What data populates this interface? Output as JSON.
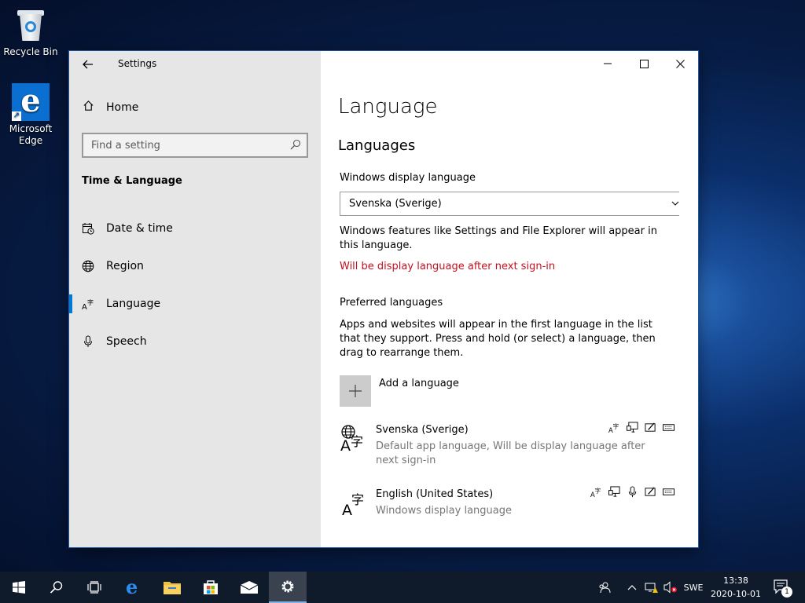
{
  "desktop": {
    "icons": [
      {
        "label": "Recycle Bin"
      },
      {
        "label": "Microsoft Edge"
      }
    ]
  },
  "window": {
    "title": "Settings",
    "sidebar": {
      "home_label": "Home",
      "search_placeholder": "Find a setting",
      "section_title": "Time & Language",
      "items": [
        {
          "label": "Date & time",
          "icon": "calendar-clock-icon"
        },
        {
          "label": "Region",
          "icon": "globe-icon"
        },
        {
          "label": "Language",
          "icon": "language-icon",
          "active": true
        },
        {
          "label": "Speech",
          "icon": "microphone-icon"
        }
      ]
    },
    "content": {
      "page_title": "Language",
      "section_title": "Languages",
      "display_language_label": "Windows display language",
      "display_language_value": "Svenska (Sverige)",
      "display_language_note": "Windows features like Settings and File Explorer will appear in this language.",
      "display_language_warning": "Will be display language after next sign-in",
      "preferred_label": "Preferred languages",
      "preferred_description": "Apps and websites will appear in the first language in the list that they support. Press and hold (or select) a language, then drag to rearrange them.",
      "add_language_label": "Add a language",
      "languages": [
        {
          "name": "Svenska (Sverige)",
          "subtitle": "Default app language, Will be display language after next sign-in"
        },
        {
          "name": "English (United States)",
          "subtitle": "Windows display language"
        }
      ]
    }
  },
  "taskbar": {
    "language_indicator": "SWE",
    "time": "13:38",
    "date": "2020-10-01",
    "notification_count": "1"
  },
  "colors": {
    "accent": "#0078d7",
    "warning": "#c50f1f",
    "sidebar_bg": "#e6e6e6",
    "taskbar_bg": "#0f1a2b"
  }
}
